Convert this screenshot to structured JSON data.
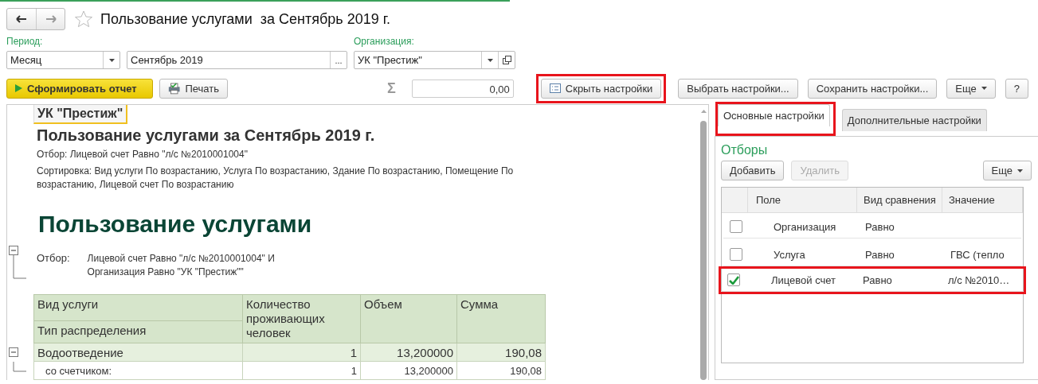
{
  "title": "Пользование услугами  за Сентябрь 2019 г.",
  "period": {
    "label": "Период:",
    "kind_value": "Месяц",
    "value": "Сентябрь 2019",
    "select_label": "..."
  },
  "organization": {
    "label": "Организация:",
    "value": "УК \"Престиж\""
  },
  "toolbar": {
    "generate": "Сформировать отчет",
    "print": "Печать",
    "sum_sign": "Σ",
    "sum_value": "0,00",
    "buttons": [
      {
        "label": "Скрыть настройки",
        "kind": "icon",
        "highlighted": true
      },
      {
        "label": "Выбрать настройки...",
        "kind": "plain",
        "highlighted": false
      },
      {
        "label": "Сохранить настройки...",
        "kind": "plain",
        "highlighted": false
      },
      {
        "label": "Еще",
        "kind": "menu",
        "highlighted": false
      },
      {
        "label": "?",
        "kind": "plain",
        "highlighted": false
      }
    ]
  },
  "report": {
    "organization": "УК \"Престиж\"",
    "title": "Пользование услугами за Сентябрь 2019 г.",
    "filter_line": "Отбор: Лицевой счет Равно \"л/с №2010001004\"",
    "sort_line": "Сортировка: Вид услуги По возрастанию, Услуга По возрастанию, Здание По возрастанию, Помещение По возрастанию, Лицевой счет По возрастанию",
    "heading": "Пользование услугами",
    "filter_label": "Отбор:",
    "filter_lines": [
      "Лицевой счет Равно \"л/с №2010001004\" И",
      "Организация Равно \"УК \"Престиж\"\""
    ],
    "columns": {
      "service": "Вид услуги",
      "distribution": "Тип распределения",
      "residents": "Количество проживающих человек",
      "volume": "Объем",
      "sum": "Сумма"
    },
    "rows": [
      {
        "service": "Водоотведение",
        "residents": "1",
        "volume": "13,200000",
        "sum": "190,08",
        "expanded": true,
        "children": [
          {
            "service": "со счетчиком:",
            "residents": "1",
            "volume": "13,200000",
            "sum": "190,08"
          }
        ]
      }
    ]
  },
  "settings": {
    "tabs": [
      {
        "label": "Основные настройки",
        "selected": true,
        "highlighted": true
      },
      {
        "label": "Дополнительные настройки",
        "selected": false,
        "highlighted": false
      }
    ],
    "section": "Отборы",
    "buttons": [
      {
        "label": "Добавить",
        "disabled": false
      },
      {
        "label": "Удалить",
        "disabled": true
      }
    ],
    "more": "Еще",
    "columns": [
      "Поле",
      "Вид сравнения",
      "Значение"
    ],
    "rows": [
      {
        "field": "Организация",
        "comparison": "Равно",
        "value": "",
        "checked": false,
        "highlighted": false
      },
      {
        "field": "Услуга",
        "comparison": "Равно",
        "value": "ГВС (тепло",
        "checked": false,
        "highlighted": false
      },
      {
        "field": "Лицевой счет",
        "comparison": "Равно",
        "value": "л/с №2010…",
        "checked": true,
        "highlighted": true
      }
    ]
  }
}
